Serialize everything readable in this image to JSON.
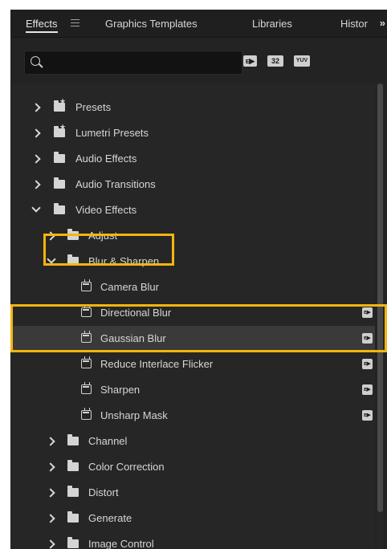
{
  "tabs": [
    {
      "label": "Effects"
    },
    {
      "label": "Graphics Templates"
    },
    {
      "label": "Libraries"
    },
    {
      "label": "Histor"
    }
  ],
  "tab_menu_icon": "hamburger-menu-icon",
  "overflow_label": "»",
  "search": {
    "placeholder": "",
    "value": ""
  },
  "filters": [
    {
      "label": "ᴇ▶",
      "icon": "accelerated-effects-filter-icon"
    },
    {
      "label": "32",
      "icon": "32-bit-filter-icon"
    },
    {
      "label": "YUV",
      "icon": "yuv-filter-icon"
    }
  ],
  "tree": {
    "items": [
      {
        "label": "Presets",
        "kind": "special-folder",
        "expanded": false
      },
      {
        "label": "Lumetri Presets",
        "kind": "special-folder",
        "expanded": false
      },
      {
        "label": "Audio Effects",
        "kind": "folder",
        "expanded": false
      },
      {
        "label": "Audio Transitions",
        "kind": "folder",
        "expanded": false
      },
      {
        "label": "Video Effects",
        "kind": "folder",
        "expanded": true
      },
      {
        "label": "Adjust",
        "kind": "folder",
        "expanded": false
      },
      {
        "label": "Blur & Sharpen",
        "kind": "folder",
        "expanded": true
      },
      {
        "label": "Camera Blur",
        "kind": "effect",
        "accelerated": false
      },
      {
        "label": "Directional Blur",
        "kind": "effect",
        "accelerated": true
      },
      {
        "label": "Gaussian Blur",
        "kind": "effect",
        "accelerated": true,
        "selected": true
      },
      {
        "label": "Reduce Interlace Flicker",
        "kind": "effect",
        "accelerated": true
      },
      {
        "label": "Sharpen",
        "kind": "effect",
        "accelerated": true
      },
      {
        "label": "Unsharp Mask",
        "kind": "effect",
        "accelerated": true
      },
      {
        "label": "Channel",
        "kind": "folder",
        "expanded": false
      },
      {
        "label": "Color Correction",
        "kind": "folder",
        "expanded": false
      },
      {
        "label": "Distort",
        "kind": "folder",
        "expanded": false
      },
      {
        "label": "Generate",
        "kind": "folder",
        "expanded": false
      },
      {
        "label": "Image Control",
        "kind": "folder",
        "expanded": false
      }
    ]
  },
  "accel_badge": "ᴇ▶",
  "colors": {
    "panel_bg": "#232323",
    "tree_bg": "#262626",
    "selected_row": "#3a3a3a",
    "text": "#d6d6d6",
    "highlight": "#f6b40e"
  }
}
